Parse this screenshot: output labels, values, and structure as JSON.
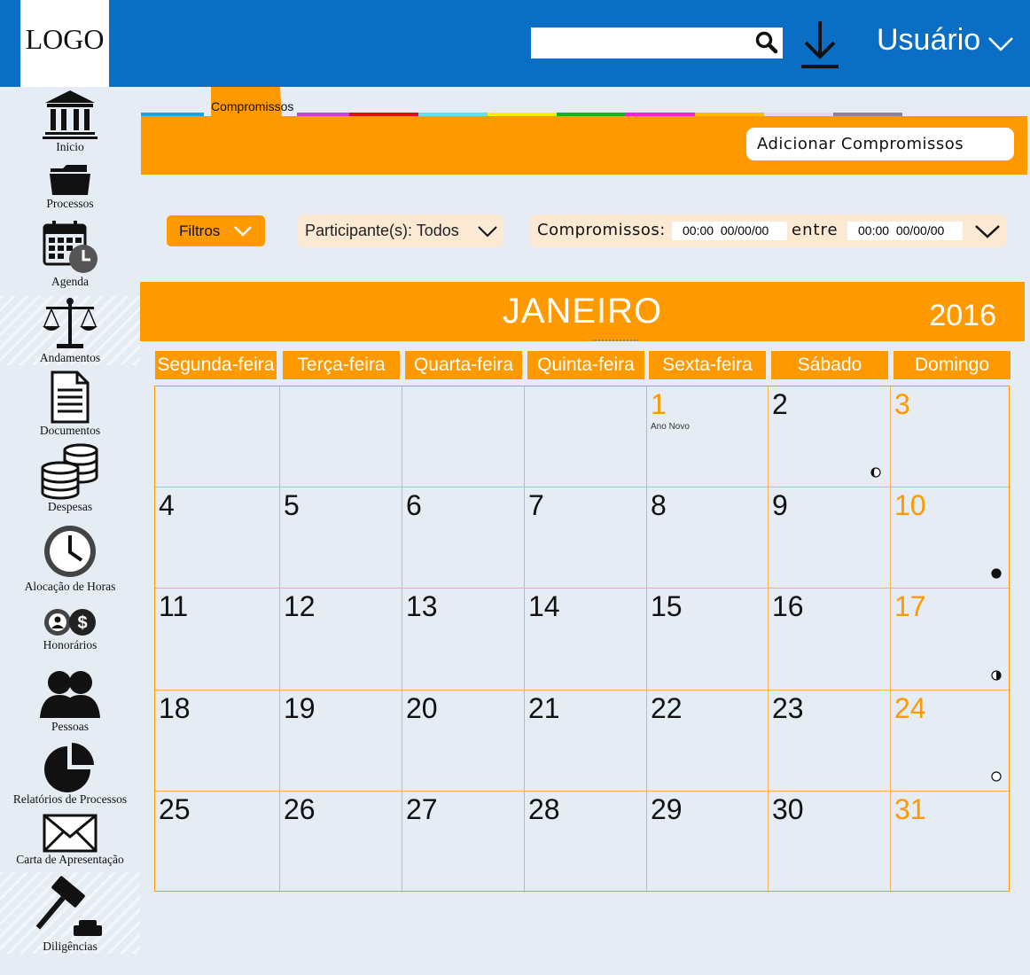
{
  "header": {
    "logo": "LOGO",
    "search_placeholder": "",
    "user_label": "Usuário"
  },
  "sidebar": {
    "items": [
      {
        "label": "Inicio",
        "icon": "bank-icon"
      },
      {
        "label": "Processos",
        "icon": "folder-icon"
      },
      {
        "label": "Agenda",
        "icon": "calendar-clock-icon"
      },
      {
        "label": "Andamentos",
        "icon": "scales-icon"
      },
      {
        "label": "Documentos",
        "icon": "document-icon"
      },
      {
        "label": "Despesas",
        "icon": "coins-stack-icon"
      },
      {
        "label": "Alocação de Horas",
        "icon": "clock-icon"
      },
      {
        "label": "Honorários",
        "icon": "fees-icon"
      },
      {
        "label": "Pessoas",
        "icon": "people-icon"
      },
      {
        "label": "Relatórios de Processos",
        "icon": "pie-chart-icon"
      },
      {
        "label": "Carta de Apresentação",
        "icon": "envelope-icon"
      },
      {
        "label": "Diligências",
        "icon": "gavel-icon"
      }
    ]
  },
  "tabs": {
    "active_label": "Compromissos",
    "strip_colors": [
      "#1aa3e8",
      "#cc44cc",
      "#dd1111",
      "#66e0e0",
      "#ffee00",
      "#22aa22",
      "#ff22cc",
      "#ffbb00",
      "#dddddd",
      "#888888"
    ]
  },
  "toolbar": {
    "add_button": "Adicionar Compromissos",
    "filters_label": "Filtros",
    "participants": "Participante(s): Todos",
    "commitments_label": "Compromissos:",
    "from_value": "00:00  00/00/00",
    "between_label": "entre",
    "to_value": "00:00  00/00/00"
  },
  "calendar": {
    "month": "JANEIRO",
    "year": "2016",
    "weekdays": [
      "Segunda-feira",
      "Terça-feira",
      "Quarta-feira",
      "Quinta-feira",
      "Sexta-feira",
      "Sábado",
      "Domingo"
    ],
    "weeks": [
      [
        "",
        "",
        "",
        "",
        "1",
        "2",
        "3"
      ],
      [
        "4",
        "5",
        "6",
        "7",
        "8",
        "9",
        "10"
      ],
      [
        "11",
        "12",
        "13",
        "14",
        "15",
        "16",
        "17"
      ],
      [
        "18",
        "19",
        "20",
        "21",
        "22",
        "23",
        "24"
      ],
      [
        "25",
        "26",
        "27",
        "28",
        "29",
        "30",
        "31"
      ]
    ],
    "notes": [
      {
        "day": "1",
        "text": "Ano Novo"
      }
    ],
    "moon_phases": [
      {
        "day": "2",
        "phase": "waning-gibbous"
      },
      {
        "day": "10",
        "phase": "new-moon"
      },
      {
        "day": "17",
        "phase": "first-quarter"
      },
      {
        "day": "24",
        "phase": "full-moon"
      }
    ],
    "accent_color": "#ff9900",
    "highlight_days": [
      "1",
      "3",
      "10",
      "17",
      "24",
      "31"
    ]
  },
  "colors": {
    "header": "#0a6ec4",
    "accent": "#ff9900",
    "background": "#e5ecf3"
  }
}
